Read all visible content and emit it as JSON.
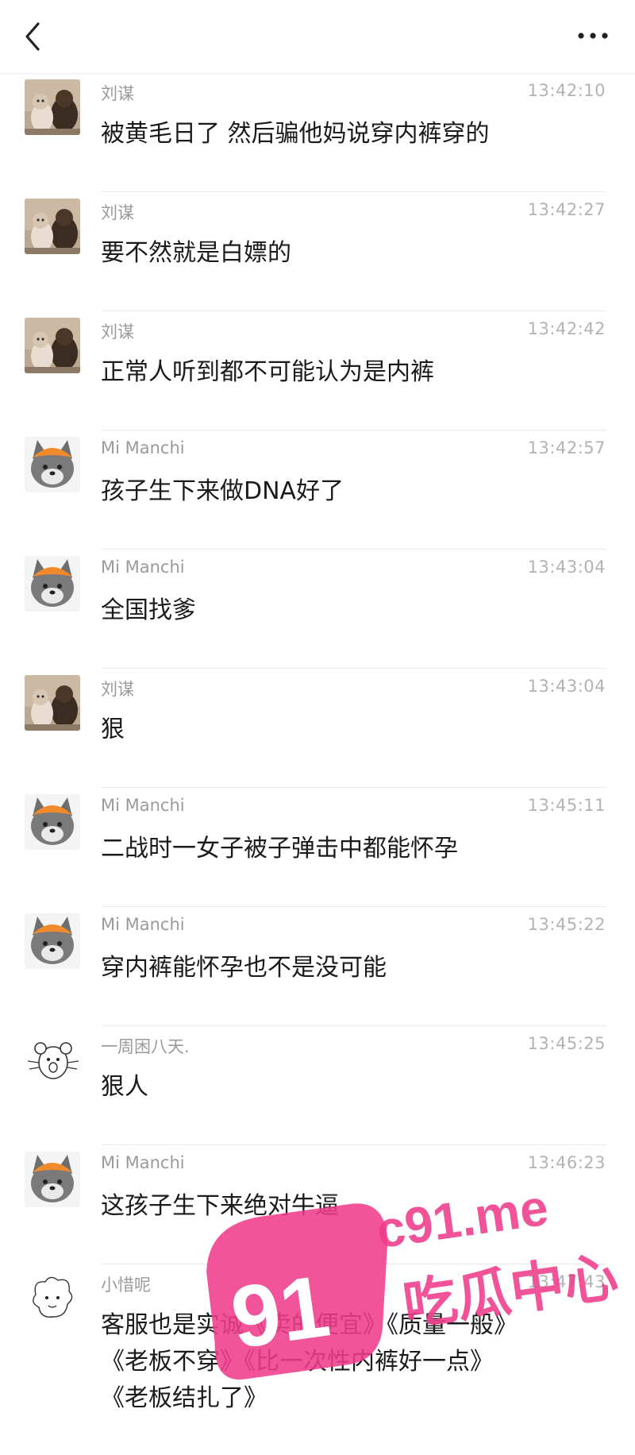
{
  "header": {
    "back_icon": "chevron-left-icon",
    "more_icon": "more-dots-icon"
  },
  "avatars": {
    "liumou": "cats-photo-avatar",
    "mimanchi": "grey-wolf-cartoon-avatar",
    "yizhou": "mouse-sketch-avatar",
    "xiaoxi": "cartoon-sketch-avatar"
  },
  "messages": [
    {
      "sender": "刘谋",
      "time": "13:42:10",
      "text": "被黄毛日了 然后骗他妈说穿内裤穿的",
      "avatar": "liumou"
    },
    {
      "sender": "刘谋",
      "time": "13:42:27",
      "text": "要不然就是白嫖的",
      "avatar": "liumou"
    },
    {
      "sender": "刘谋",
      "time": "13:42:42",
      "text": "正常人听到都不可能认为是内裤",
      "avatar": "liumou"
    },
    {
      "sender": "Mi Manchi",
      "time": "13:42:57",
      "text": "孩子生下来做DNA好了",
      "avatar": "mimanchi"
    },
    {
      "sender": "Mi Manchi",
      "time": "13:43:04",
      "text": "全国找爹",
      "avatar": "mimanchi"
    },
    {
      "sender": "刘谋",
      "time": "13:43:04",
      "text": "狠",
      "avatar": "liumou"
    },
    {
      "sender": "Mi Manchi",
      "time": "13:45:11",
      "text": "二战时一女子被子弹击中都能怀孕",
      "avatar": "mimanchi"
    },
    {
      "sender": "Mi Manchi",
      "time": "13:45:22",
      "text": "穿内裤能怀孕也不是没可能",
      "avatar": "mimanchi"
    },
    {
      "sender": "一周困八天.",
      "time": "13:45:25",
      "text": "狠人",
      "avatar": "yizhou"
    },
    {
      "sender": "Mi Manchi",
      "time": "13:46:23",
      "text": "这孩子生下来绝对牛逼",
      "avatar": "mimanchi"
    },
    {
      "sender": "小惜呢",
      "time": "13:47:43",
      "text_lines": [
        "客服也是实诚《卖的便宜》《质量一般》",
        "《老板不穿》《比一次性内裤好一点》",
        "《老板结扎了》"
      ],
      "avatar": "xiaoxi"
    }
  ],
  "watermark": {
    "number": "91",
    "site": "c91.me",
    "caption": "吃瓜中心",
    "color": "#f03c8c"
  }
}
